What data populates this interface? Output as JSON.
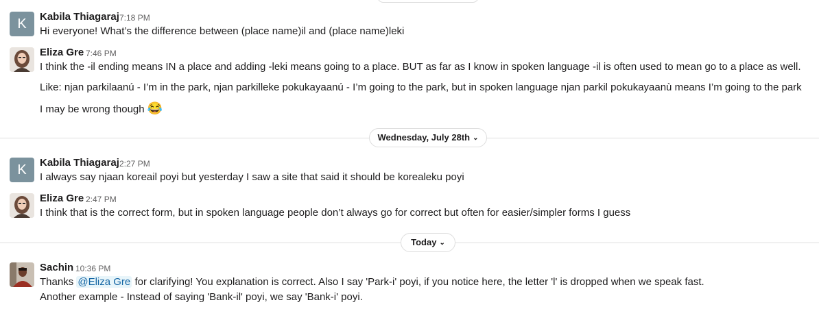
{
  "messages": [
    {
      "author": "Kabila Thiagaraj",
      "initial": "K",
      "time": "7:18 PM",
      "lines": [
        "Hi everyone! What’s the difference between (place name)il and (place name)leki"
      ]
    },
    {
      "author": "Eliza Gre",
      "time": "7:46 PM",
      "lines": [
        "I think the -il ending means IN a place and adding -leki means going to a place. BUT as far as I know in spoken language -il is often used to mean go to a place as well.",
        "Like: njan parkilaanú - I’m in the park, njan parkilleke pokukayaanú - I’m going to the park, but in spoken language njan parkil pokukayaanù means I’m going to the park",
        "I may be wrong though"
      ],
      "emoji": "😂"
    },
    {
      "author": "Kabila Thiagaraj",
      "initial": "K",
      "time": "2:27 PM",
      "lines": [
        "I always say njaan koreail poyi but yesterday I saw a site that said it should be korealeku poyi"
      ]
    },
    {
      "author": "Eliza Gre",
      "time": "2:47 PM",
      "lines": [
        "I think that is the correct form, but in spoken language people don’t always go for correct but often for easier/simpler forms I guess"
      ]
    },
    {
      "author": "Sachin",
      "time": "10:36 PM",
      "line1_prefix": "Thanks ",
      "mention": "@Eliza Gre",
      "line1_suffix": " for clarifying! You explanation is correct. Also I say 'Park-i' poyi, if you notice here, the letter 'l' is dropped when we speak fast.",
      "line2": "Another example - Instead of saying 'Bank-il' poyi, we say 'Bank-i' poyi."
    }
  ],
  "dividers": {
    "wednesday": "Wednesday, July 28th",
    "today": "Today"
  },
  "icons": {
    "chevron": "chevron-down-icon",
    "emoji": "joy-emoji-icon"
  }
}
